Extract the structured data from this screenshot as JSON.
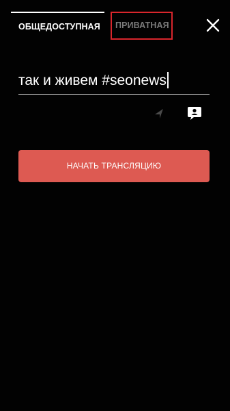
{
  "tabs": {
    "public_label": "ОБЩЕДОСТУПНАЯ",
    "private_label": "ПРИВАТНАЯ"
  },
  "stream_title": {
    "value": "так и живем #seonews"
  },
  "start_button": {
    "label": "НАЧАТЬ ТРАНСЛЯЦИЮ"
  },
  "icons": {
    "close": "close-icon",
    "location": "location-arrow-icon",
    "chat": "chat-bubble-user-icon"
  },
  "colors": {
    "background": "#020202",
    "accent_button": "#dd5a52",
    "highlight_border": "#d9262c",
    "inactive_tab": "#7a7a7a",
    "text": "#ffffff"
  }
}
